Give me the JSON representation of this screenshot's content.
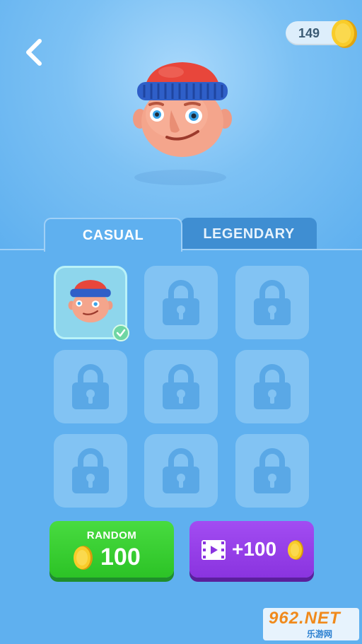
{
  "header": {
    "coins": "149",
    "back_icon": "chevron-left-icon",
    "coin_icon": "gold-coin-icon"
  },
  "preview": {
    "character": "red-beanie-boy"
  },
  "tabs": [
    {
      "label": "CASUAL",
      "active": true
    },
    {
      "label": "LEGENDARY",
      "active": false
    }
  ],
  "grid": {
    "slots": [
      {
        "state": "unlocked",
        "selected": true,
        "character": "red-beanie-boy"
      },
      {
        "state": "locked"
      },
      {
        "state": "locked"
      },
      {
        "state": "locked"
      },
      {
        "state": "locked"
      },
      {
        "state": "locked"
      },
      {
        "state": "locked"
      },
      {
        "state": "locked"
      },
      {
        "state": "locked"
      }
    ]
  },
  "buttons": {
    "random": {
      "label": "RANDOM",
      "amount": "100"
    },
    "video": {
      "amount": "+100",
      "icon": "video-clip-icon"
    }
  },
  "watermark": {
    "main": "962.NET",
    "sub": "乐游网"
  },
  "colors": {
    "background": "#5fb0ef",
    "slot": "#82c3f3",
    "random_button": "#2cc326",
    "video_button": "#8a34df",
    "coin": "#f7c21d"
  }
}
